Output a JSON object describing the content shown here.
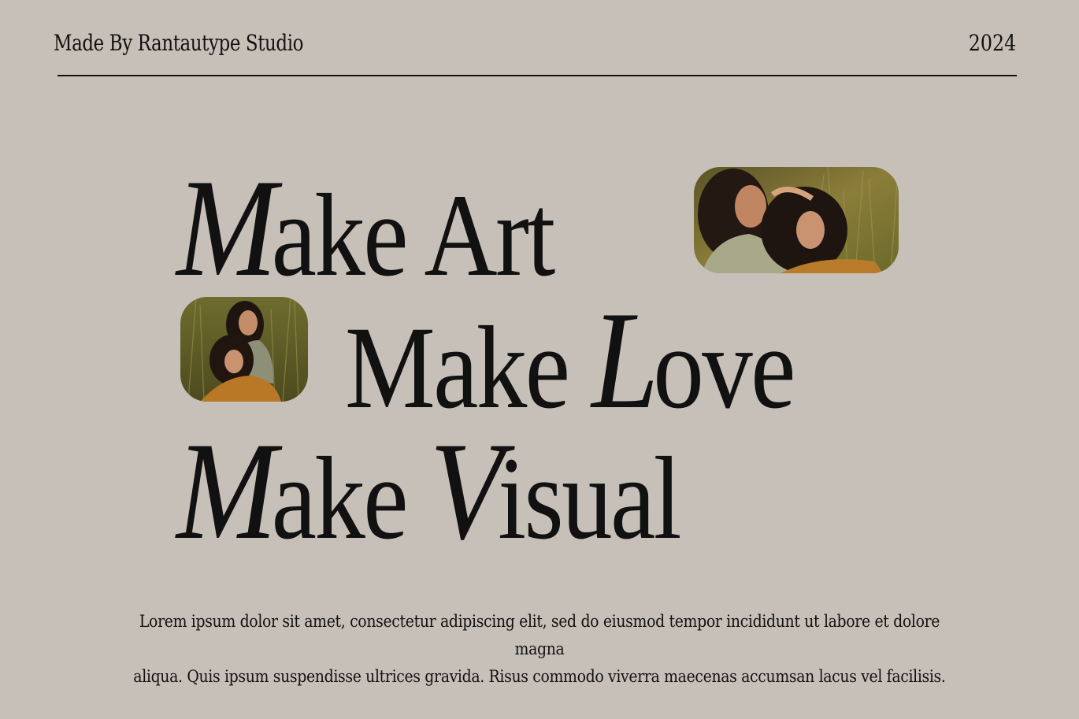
{
  "header": {
    "credit": "Made By Rantautype Studio",
    "year": "2024"
  },
  "headline": {
    "line1": {
      "cap": "M",
      "rest": "ake Art"
    },
    "line2": {
      "word": "Make ",
      "cap": "L",
      "rest": "ove"
    },
    "line3": {
      "cap1": "M",
      "rest1": "ake ",
      "cap2": "V",
      "rest2": "isual"
    }
  },
  "photos": [
    {
      "name": "two-women-in-grass-landscape"
    },
    {
      "name": "two-women-in-grass-portrait"
    }
  ],
  "body": {
    "line1": "Lorem ipsum dolor sit amet, consectetur adipiscing elit, sed do eiusmod tempor incididunt ut labore et dolore magna",
    "line2": "aliqua. Quis ipsum suspendisse ultrices gravida. Risus commodo viverra maecenas accumsan lacus vel facilisis."
  },
  "colors": {
    "background": "#c7c0b9",
    "text": "#111111",
    "grass": "#6e6a2e",
    "skin": "#c98f6c"
  }
}
